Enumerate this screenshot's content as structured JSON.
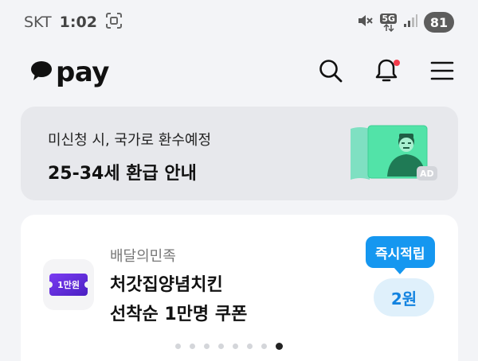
{
  "status_bar": {
    "carrier": "SKT",
    "time": "1:02",
    "network": "5G",
    "battery": "81"
  },
  "header": {
    "logo_text": "pay",
    "icons": [
      "search-icon",
      "bell-icon",
      "menu-icon"
    ],
    "notification_dot_color": "#f43b4b"
  },
  "ad_banner": {
    "subtitle": "미신청 시, 국가로 환수예정",
    "title": "25-34세 환급 안내",
    "badge": "AD"
  },
  "coupon_card": {
    "merchant": "배달의민족",
    "title_line1": "처갓집양념치킨",
    "title_line2": "선착순 1만명 쿠폰",
    "thumb_label": "1만원",
    "reward_tag": "즉시적립",
    "reward_amount": "2원",
    "pager": {
      "total": 8,
      "active": 8
    }
  },
  "colors": {
    "accent": "#1597f0",
    "background": "#f3f4f7",
    "card": "#ffffff",
    "banner": "#e7e8ec"
  }
}
